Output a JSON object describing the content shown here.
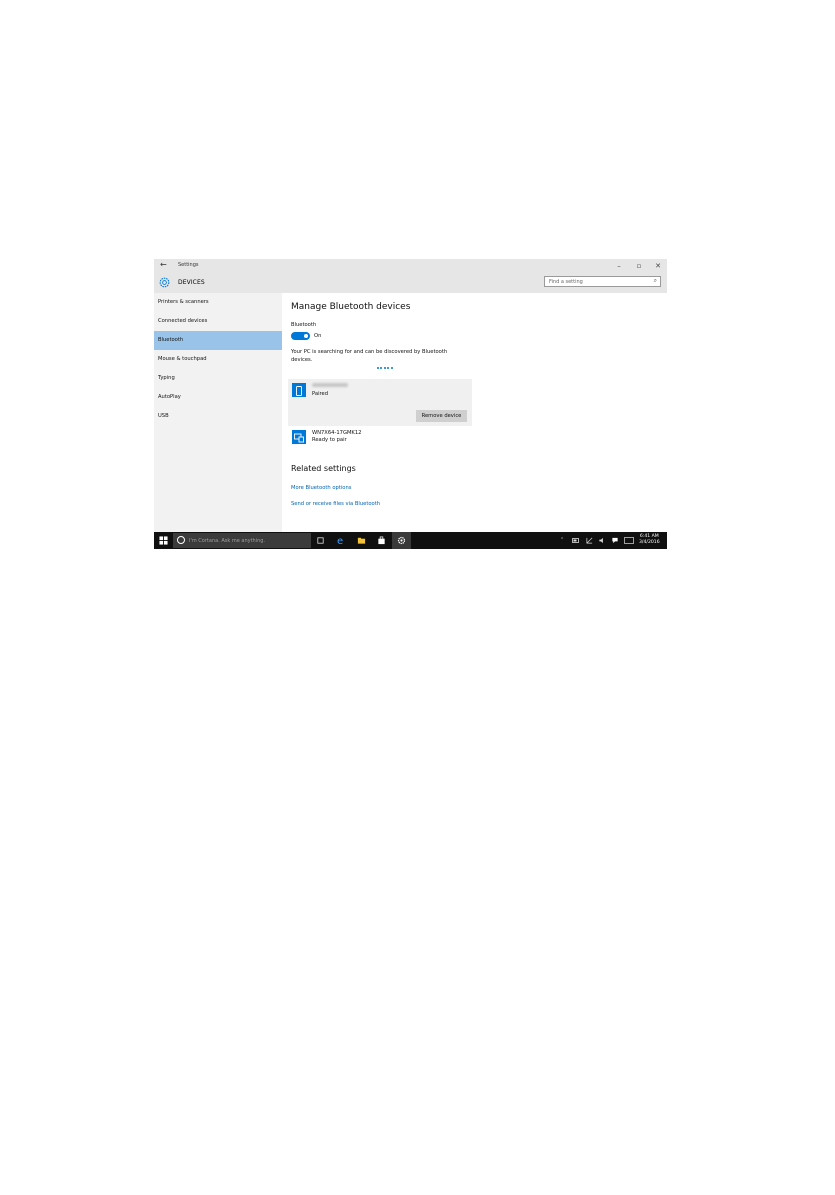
{
  "titlebar": {
    "back_icon": "back-arrow-icon",
    "title": "Settings",
    "minimize": "–",
    "restore": "▫",
    "close": "✕"
  },
  "header": {
    "category": "DEVICES",
    "icon": "gear-icon",
    "search_placeholder": "Find a setting",
    "search_icon": "search-icon"
  },
  "sidebar": {
    "items": [
      {
        "label": "Printers & scanners"
      },
      {
        "label": "Connected devices"
      },
      {
        "label": "Bluetooth",
        "selected": true
      },
      {
        "label": "Mouse & touchpad"
      },
      {
        "label": "Typing"
      },
      {
        "label": "AutoPlay"
      },
      {
        "label": "USB"
      }
    ]
  },
  "main": {
    "title": "Manage Bluetooth devices",
    "bluetooth_label": "Bluetooth",
    "toggle_state": "On",
    "status_line1": "Your PC is searching for and can be discovered by Bluetooth",
    "status_line2": "devices.",
    "devices": [
      {
        "status": "Paired",
        "icon": "phone-icon",
        "action": "Remove device"
      },
      {
        "name": "WN7X64-17GMK12",
        "status": "Ready to pair",
        "icon": "computer-icon"
      }
    ],
    "related_title": "Related settings",
    "links": [
      "More Bluetooth options",
      "Send or receive files via Bluetooth"
    ]
  },
  "taskbar": {
    "cortana_placeholder": "I'm Cortana. Ask me anything.",
    "time": "6:41 AM",
    "date": "3/4/2016"
  },
  "colors": {
    "accent": "#0078d7",
    "selected_nav": "#99c3e8",
    "taskbar": "#101010"
  }
}
